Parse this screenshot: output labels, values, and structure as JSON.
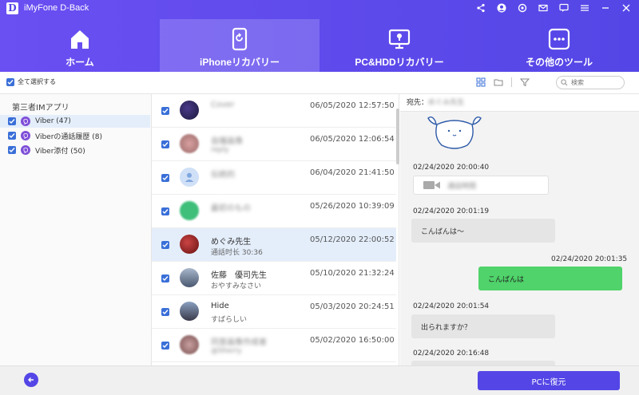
{
  "app": {
    "title": "iMyFone D-Back",
    "logo_letter": "D"
  },
  "nav": {
    "tabs": [
      {
        "label": "ホーム"
      },
      {
        "label": "iPhoneリカバリー"
      },
      {
        "label": "PC&HDDリカバリー"
      },
      {
        "label": "その他のツール"
      }
    ],
    "active_index": 1
  },
  "toolbar": {
    "select_all_label": "全て選択する",
    "search_placeholder": "検索"
  },
  "sidebar": {
    "header": "第三者IMアプリ",
    "items": [
      {
        "label": "Viber (47)"
      },
      {
        "label": "Viberの通話履歴 (8)"
      },
      {
        "label": "Viber添付 (50)"
      }
    ]
  },
  "list": {
    "rows": [
      {
        "name": "Cover",
        "sub": "",
        "date": "06/05/2020 12:57:50",
        "blurred": true
      },
      {
        "name": "自撮画像",
        "sub": "reply",
        "date": "06/05/2020 12:06:54",
        "blurred": true
      },
      {
        "name": "伝統的",
        "sub": "",
        "date": "06/04/2020 21:41:50",
        "blurred": true
      },
      {
        "name": "最初のもの",
        "sub": "",
        "date": "05/26/2020 10:39:09",
        "blurred": true
      },
      {
        "name": "めぐみ先生",
        "sub": "通話时长 30:36",
        "date": "05/12/2020 22:00:52",
        "blurred": false
      },
      {
        "name": "佐藤　優司先生",
        "sub": "おやすみなさい",
        "date": "05/10/2020 21:32:24",
        "blurred": false
      },
      {
        "name": "Hide",
        "sub": "すばらしい",
        "date": "05/03/2020 20:24:51",
        "blurred": false
      },
      {
        "name": "同意画像作成者",
        "sub": "@Sherry",
        "date": "05/02/2020 16:50:00",
        "blurred": true
      }
    ]
  },
  "chat": {
    "recipient_prefix": "宛先：",
    "recipient_name": "めぐみ先生",
    "messages": [
      {
        "time": "02/24/2020 20:00:40",
        "text": "通話時間",
        "kind": "call"
      },
      {
        "time": "02/24/2020 20:01:19",
        "text": "こんばんは～",
        "kind": "in"
      },
      {
        "time": "02/24/2020 20:01:35",
        "text": "こんばんは",
        "kind": "out"
      },
      {
        "time": "02/24/2020 20:01:54",
        "text": "出られますか？",
        "kind": "in"
      },
      {
        "time": "02/24/2020 20:16:48",
        "text": "",
        "kind": "in"
      }
    ]
  },
  "footer": {
    "restore_label": "PCに復元"
  },
  "colors": {
    "brand": "#5446e6",
    "selected_row": "#e4eefb",
    "outgoing_bubble": "#4fd36a"
  }
}
